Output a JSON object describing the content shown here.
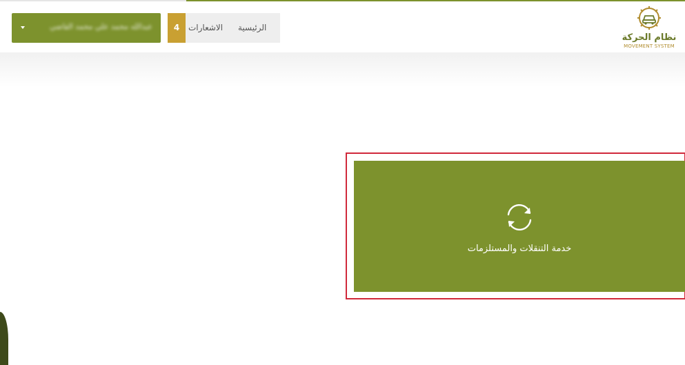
{
  "header": {
    "user_menu_label": "عبدالله محمد علي محمد القاضي",
    "notifications_count": "4",
    "notifications_label": "الاشعارات",
    "home_label": "الرئيسية",
    "logo_text_ar": "نظام الحركة",
    "logo_text_en": "MOVEMENT SYSTEM"
  },
  "main": {
    "service_card_label": "خدمة التنقلات والمستلزمات",
    "service_card_icon": "sync-icon"
  },
  "colors": {
    "brand_green": "#7d922d",
    "badge_gold": "#c9a032",
    "highlight_red": "#d0283a"
  }
}
